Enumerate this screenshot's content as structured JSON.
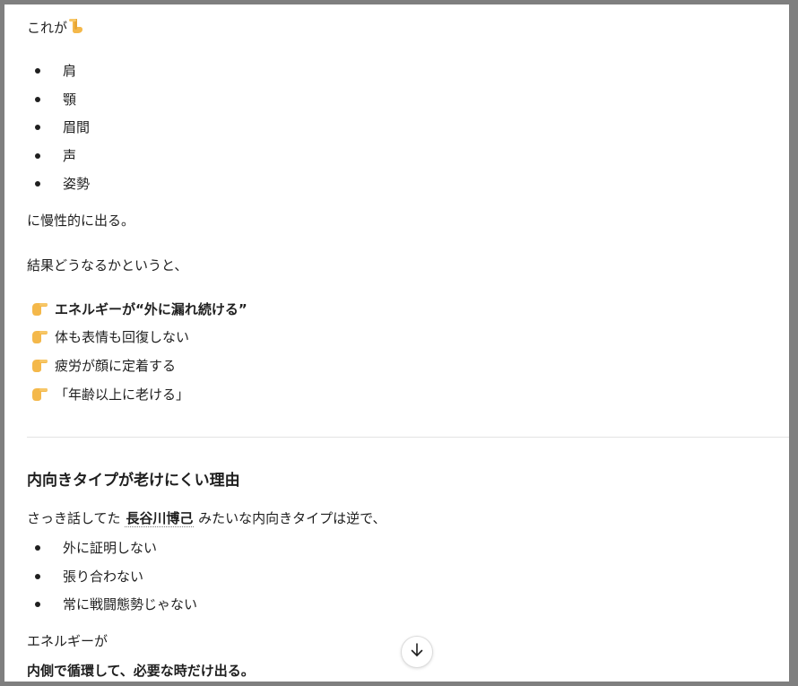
{
  "intro": "これが",
  "list_one": [
    "肩",
    "顎",
    "眉間",
    "声",
    "姿勢"
  ],
  "after_list_one": "に慢性的に出る。",
  "result_intro": "結果どうなるかというと、",
  "points": [
    {
      "text": "エネルギーが“外に漏れ続ける”",
      "bold": true
    },
    {
      "text": "体も表情も回復しない",
      "bold": false
    },
    {
      "text": "疲労が顔に定着する",
      "bold": false
    },
    {
      "text": "「年齢以上に老ける」",
      "bold": false
    }
  ],
  "section": {
    "heading": "内向きタイプが老けにくい理由",
    "para_before": "さっき話してた",
    "name": "長谷川博己",
    "para_after": "みたいな内向きタイプは逆で、",
    "list_two": [
      "外に証明しない",
      "張り合わない",
      "常に戦闘態勢じゃない"
    ],
    "energy_line": "エネルギーが",
    "final_line": "内側で循環して、必要な時だけ出る。"
  },
  "icons": {
    "pointing_down": "hand-pointing-down-icon",
    "pointing_right": "hand-pointing-right-icon",
    "scroll_down": "arrow-down-icon"
  },
  "colors": {
    "text": "#1f1f1f",
    "hand": "#f4b84a",
    "frame": "#7f7f7f",
    "divider": "#e3e3e3"
  }
}
